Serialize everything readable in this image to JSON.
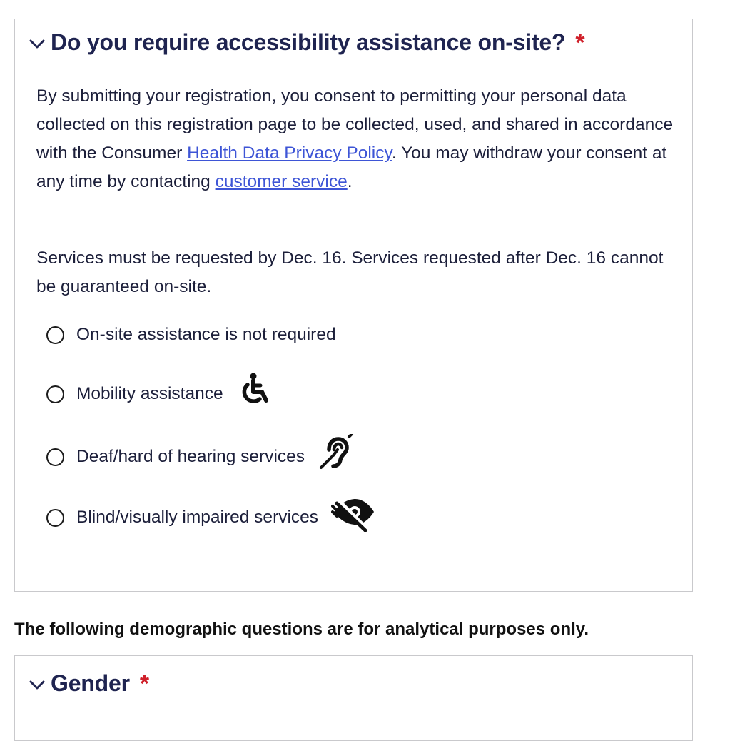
{
  "accessibility": {
    "question": "Do you require accessibility assistance on-site?",
    "required_mark": "*",
    "consent": {
      "text_before_link": "By submitting your registration, you consent to permitting your personal data collected on this registration page to be collected, used, and shared in accordance with the Consumer ",
      "privacy_link": "Health Data Privacy Policy",
      "text_middle": ". You may withdraw your consent at any time by contacting ",
      "service_link": "customer service",
      "text_end": "."
    },
    "deadline": "Services must be requested by Dec. 16. Services requested after Dec. 16 cannot be guaranteed on-site.",
    "options": [
      {
        "label": "On-site assistance is not required",
        "icon": ""
      },
      {
        "label": "Mobility assistance",
        "icon": "wheelchair-icon"
      },
      {
        "label": "Deaf/hard of hearing services",
        "icon": "hearing-impaired-icon"
      },
      {
        "label": "Blind/visually impaired services",
        "icon": "visually-impaired-icon"
      }
    ]
  },
  "demographic_note": "The following demographic questions are for analytical purposes only.",
  "gender": {
    "question": "Gender",
    "required_mark": "*"
  },
  "colors": {
    "heading": "#1f2450",
    "required": "#d0202a",
    "link": "#3e55d6",
    "border": "#c9c9cc"
  }
}
